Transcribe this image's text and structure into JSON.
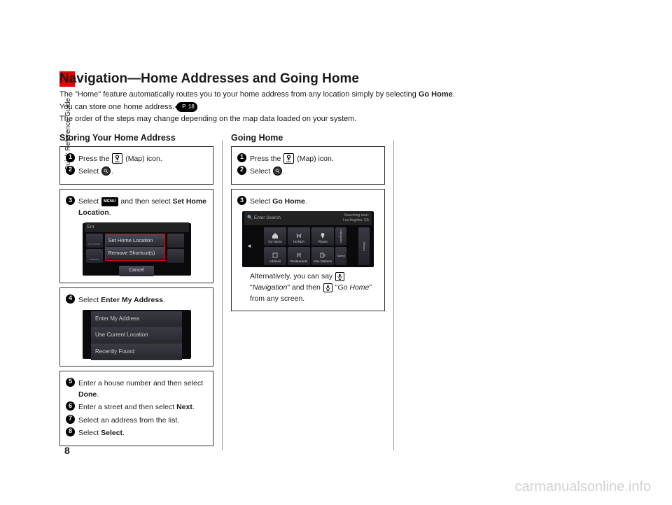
{
  "sidebar": {
    "label": "Quick Reference Guide"
  },
  "page_number": "8",
  "header": {
    "title": "Navigation—Home Addresses and Going Home",
    "intro1a": "The \"Home\" feature automatically routes you to your home address from any location simply by selecting ",
    "intro1b": "Go Home",
    "intro1c": ".",
    "intro2": "You can store one home address.",
    "intro2_ref": "P. 18",
    "intro3": "The order of the steps may change depending on the map data loaded on your system."
  },
  "storing": {
    "heading": "Storing Your Home Address",
    "step1a": "Press the ",
    "step1b": " (Map) icon.",
    "step2a": "Select ",
    "step2b": ".",
    "step3a": "Select ",
    "step3b": " and then select ",
    "step3c": "Set Home Location",
    "step3d": ".",
    "popup": {
      "item1": "Set Home Location",
      "item2": "Remove Shortcut(s)",
      "cancel": "Cancel"
    },
    "ghosts": {
      "t1": "Go Home",
      "t2": "Address",
      "bar": "Ent"
    },
    "step4a": "Select ",
    "step4b": "Enter My Address",
    "step4c": ".",
    "menu": {
      "i1": "Enter My Address",
      "i2": "Use Current Location",
      "i3": "Recently Found"
    },
    "step5a": "Enter a house number and then select ",
    "step5b": "Done",
    "step5c": ".",
    "step6a": "Enter a street and then select ",
    "step6b": "Next",
    "step6c": ".",
    "step7": "Select an address from the list.",
    "step8a": "Select ",
    "step8b": "Select",
    "step8c": "."
  },
  "going": {
    "heading": "Going Home",
    "step1a": "Press the ",
    "step1b": " (Map) icon.",
    "step2a": "Select ",
    "step2b": ".",
    "step3a": "Select ",
    "step3b": "Go Home",
    "step3c": ".",
    "navbar": {
      "search": "Enter Search",
      "loc": "Searching near:\nLos Angeles, CA"
    },
    "tiles": {
      "t1": "Go Home",
      "t2": "HONDA",
      "t3": "Places",
      "t4": "Categories",
      "t5": "Address",
      "t6": "Restaurants",
      "t7": "Gas Stations",
      "s1": "Saved",
      "s2": "Recent"
    },
    "alt1": "Alternatively, you can say ",
    "alt2": "\"",
    "alt3": "Navigation",
    "alt4": "\" and then ",
    "alt5": " \"",
    "alt6": "Go Home",
    "alt7": "\" from any screen."
  },
  "watermark": "carmanualsonline.info"
}
